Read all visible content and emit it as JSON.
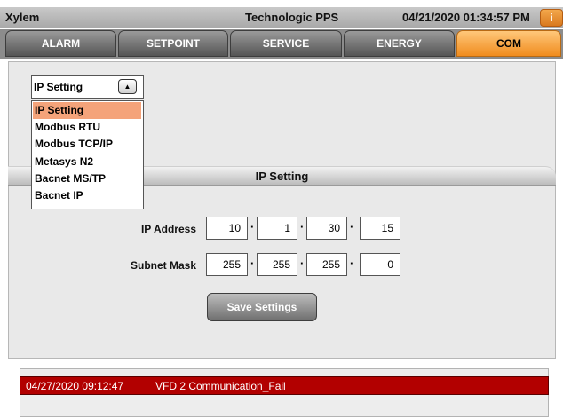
{
  "title_bar": {
    "brand": "Xylem",
    "product": "Technologic PPS",
    "datetime": "04/21/2020 01:34:57 PM",
    "info_icon_label": "i"
  },
  "tabs": [
    {
      "label": "ALARM",
      "active": false
    },
    {
      "label": "SETPOINT",
      "active": false
    },
    {
      "label": "SERVICE",
      "active": false
    },
    {
      "label": "ENERGY",
      "active": false
    },
    {
      "label": "COM",
      "active": true
    }
  ],
  "protocol_select": {
    "value": "IP Setting",
    "arrow_icon": "triangle-up-icon",
    "options": [
      "IP Setting",
      "Modbus RTU",
      "Modbus TCP/IP",
      "Metasys N2",
      "Bacnet MS/TP",
      "Bacnet IP"
    ],
    "selected_option": "IP Setting"
  },
  "section": {
    "title": "IP Setting"
  },
  "ip_address": {
    "label": "IP Address",
    "octets": [
      "10",
      "1",
      "30",
      "15"
    ]
  },
  "subnet_mask": {
    "label": "Subnet Mask",
    "octets": [
      "255",
      "255",
      "255",
      "0"
    ]
  },
  "separator": "·",
  "save_button": {
    "label": "Save Settings"
  },
  "alarm": {
    "timestamp": "04/27/2020 09:12:47",
    "message": "VFD 2 Communication_Fail"
  },
  "colors": {
    "active_tab": "#f08c1e",
    "alarm_row": "#b20000",
    "selected_option": "#f4a37a"
  }
}
